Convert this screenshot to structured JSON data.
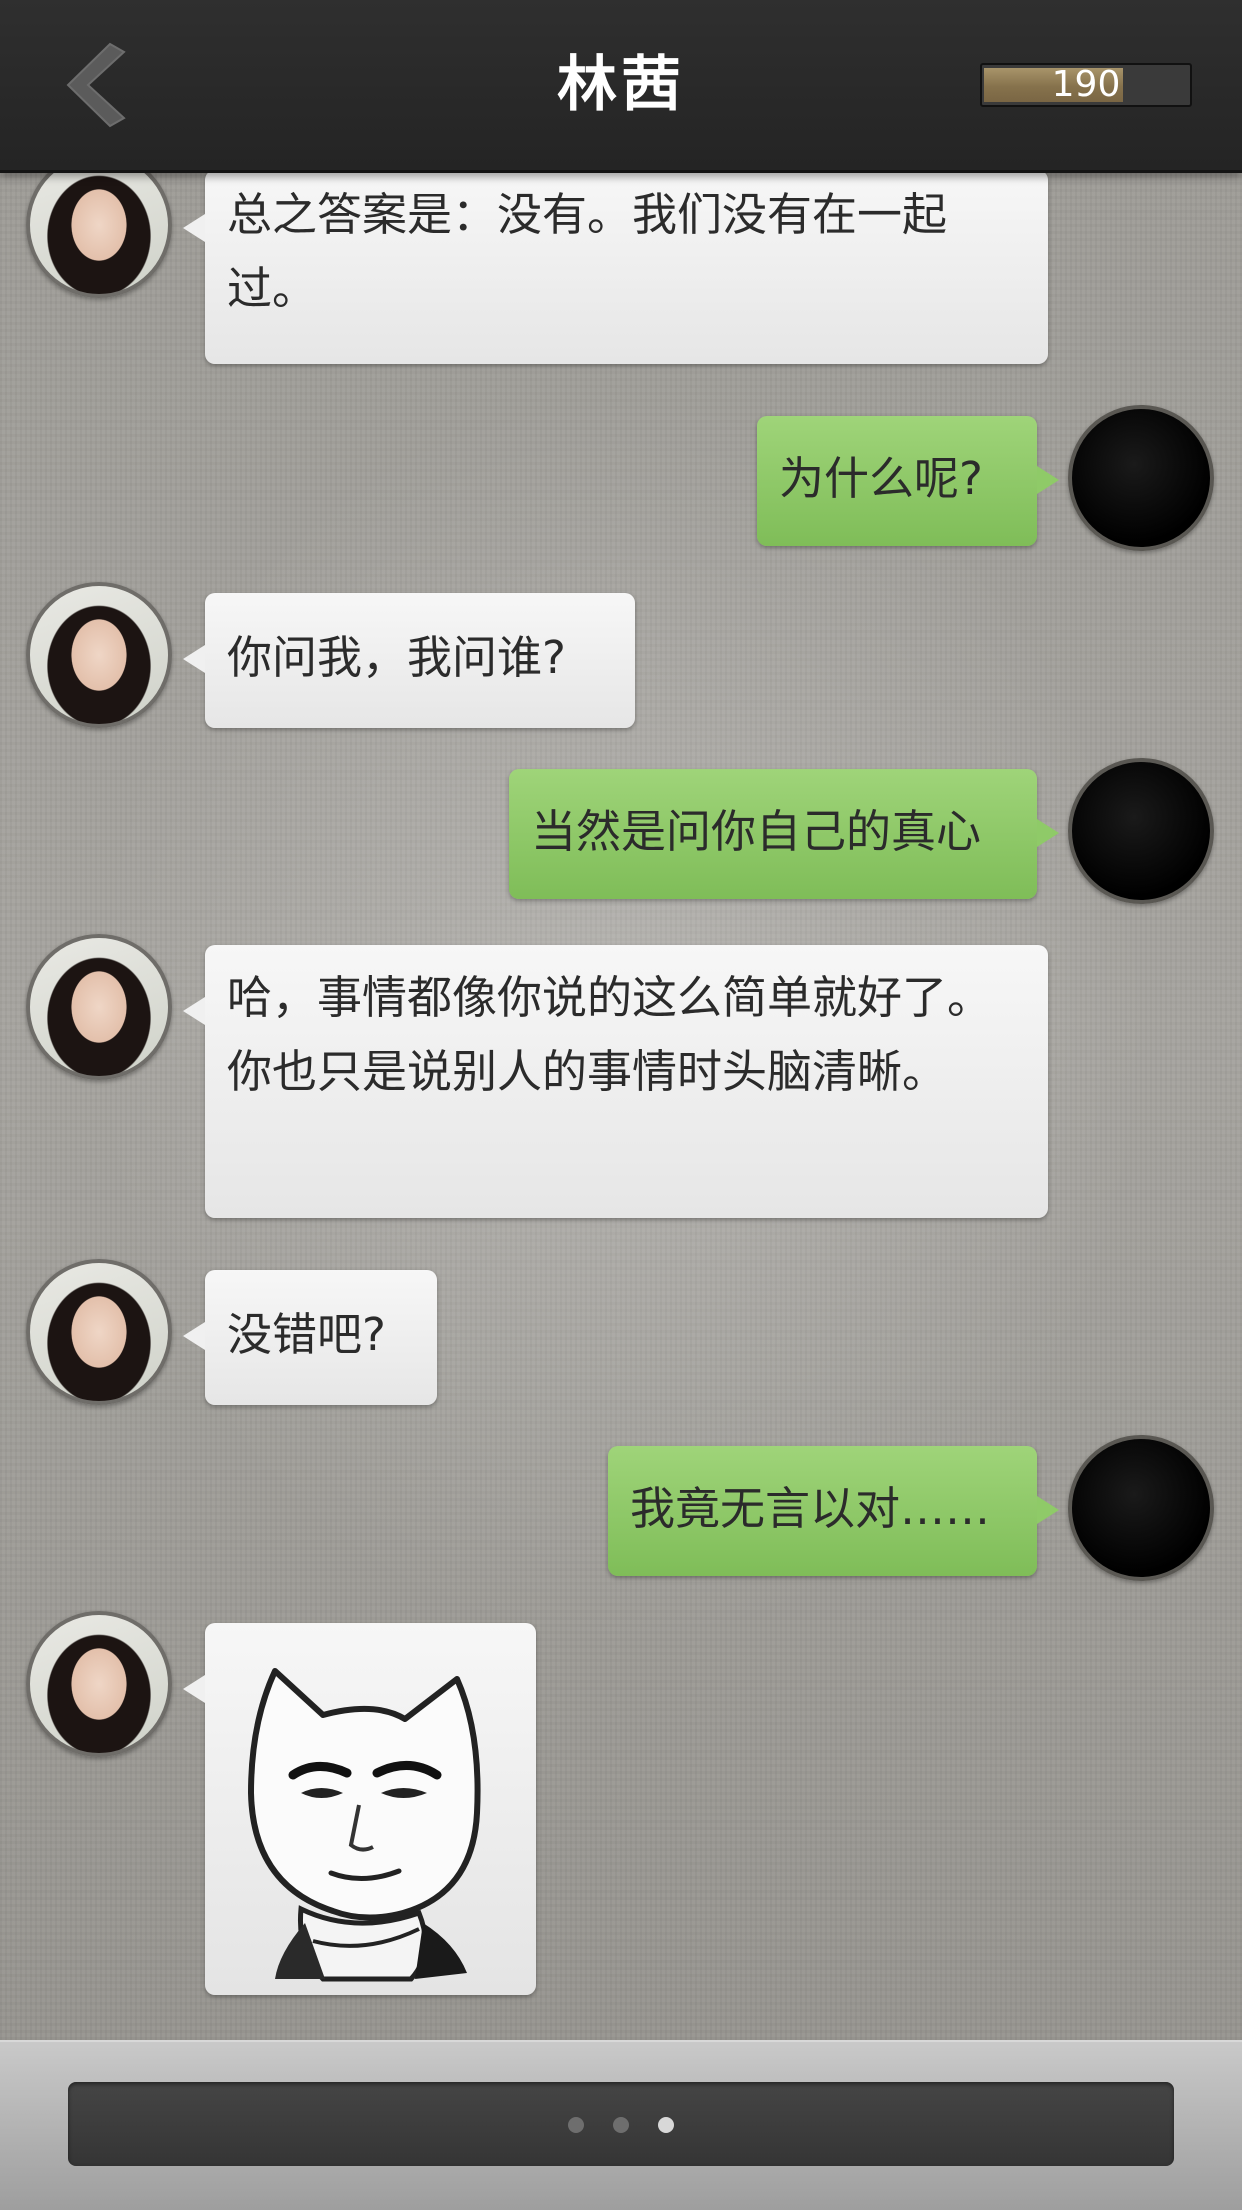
{
  "header": {
    "title": "林茜",
    "score": "190",
    "score_fill_fraction": 0.68
  },
  "messages": [
    {
      "sender": "林茜",
      "side": "left",
      "text": "总之答案是：没有。我们没有在一起过。"
    },
    {
      "sender": "me",
      "side": "right",
      "text": "为什么呢?"
    },
    {
      "sender": "林茜",
      "side": "left",
      "text": "你问我，我问谁?"
    },
    {
      "sender": "me",
      "side": "right",
      "text": "当然是问你自己的真心"
    },
    {
      "sender": "林茜",
      "side": "left",
      "text": "哈，事情都像你说的这么简单就好了。你也只是说别人的事情时头脑清晰。"
    },
    {
      "sender": "林茜",
      "side": "left",
      "text": "没错吧?"
    },
    {
      "sender": "me",
      "side": "right",
      "text": "我竟无言以对……"
    },
    {
      "sender": "林茜",
      "side": "left",
      "type": "sticker",
      "sticker": "cat-face-meme-sticker"
    }
  ],
  "bottom": {
    "page_indicator": {
      "count": 3,
      "active": 3
    }
  },
  "colors": {
    "header_bg": "#2a2a2a",
    "bubble_left": "#f0f0f0",
    "bubble_right": "#8fca68",
    "score_bar": "#8a7650",
    "input_bar": "#3d3d3d"
  },
  "icons": {
    "back": "chevron-left-icon"
  }
}
